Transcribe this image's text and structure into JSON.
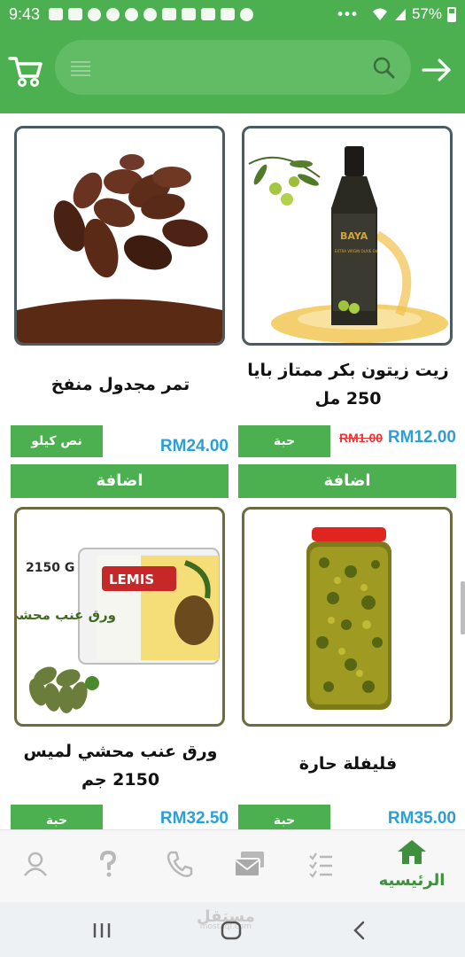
{
  "status_bar": {
    "time": "9:43",
    "battery": "57%"
  },
  "header": {
    "search_placeholder": ""
  },
  "products": [
    {
      "name": "زيت زيتون  بكر ممتاز بايا 250 مل",
      "price": "RM12.00",
      "old_price": "RM1.00",
      "unit": "حبة",
      "add_label": "اضافة"
    },
    {
      "name": "تمر مجدول منفخ",
      "price": "RM24.00",
      "unit": "نص كيلو",
      "add_label": "اضافة"
    },
    {
      "name": "فليفلة حارة",
      "price": "RM35.00",
      "unit": "حبة"
    },
    {
      "name": "ورق عنب محشي لميس 2150 جم",
      "price": "RM32.50",
      "unit": "حبة"
    }
  ],
  "product_images": {
    "olive_oil_brand": "BAYA",
    "olive_oil_label": "EXTRA VIRGIN OLIVE OIL",
    "grape_leaves_brand": "LEMIS",
    "grape_leaves_arabic": "ورق عنب محشي",
    "grape_leaves_weight": "2150 G"
  },
  "bottom_nav": {
    "home_label": "الرئيسيه"
  },
  "watermark": {
    "main": "مستقل",
    "sub": "mostaql.com"
  },
  "colors": {
    "primary": "#4caf50",
    "price": "#2a9fd8",
    "old_price": "#e33333"
  }
}
